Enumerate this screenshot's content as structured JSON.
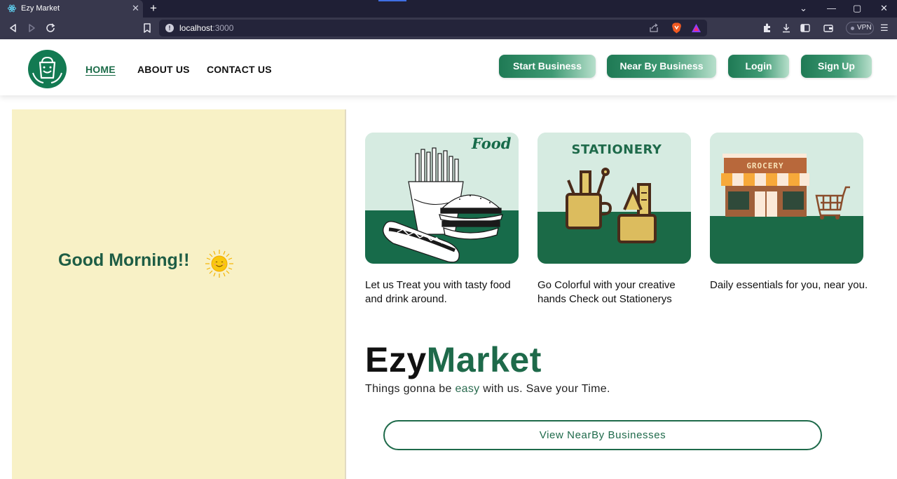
{
  "browser": {
    "tab_title": "Ezy Market",
    "url_host": "localhost",
    "url_port": ":3000",
    "vpn_label": "VPN"
  },
  "nav": {
    "links": [
      {
        "label": "HOME",
        "active": true
      },
      {
        "label": "ABOUT US",
        "active": false
      },
      {
        "label": "CONTACT US",
        "active": false
      }
    ],
    "buttons": {
      "start_business": "Start Business",
      "near_by_business": "Near By Business",
      "login": "Login",
      "signup": "Sign Up"
    }
  },
  "greeting": {
    "text": "Good Morning!!"
  },
  "categories": [
    {
      "image_label": "Food",
      "caption": "Let us Treat you with tasty food and drink around."
    },
    {
      "image_label": "STATIONERY",
      "caption": "Go Colorful with your creative hands Check out Stationerys"
    },
    {
      "image_label": "GROCERY",
      "caption": "Daily essentials for you, near you."
    }
  ],
  "brand": {
    "part1": "Ezy",
    "part2": "Market",
    "tagline_before": "Things gonna be ",
    "tagline_highlight": "easy",
    "tagline_after": " with us. Save your Time."
  },
  "cta": {
    "label": "View NearBy Businesses"
  },
  "colors": {
    "primary": "#1e6a4a",
    "panel": "#f8f1c6",
    "card_top": "#d6ebe1",
    "card_bottom": "#176b4a"
  }
}
